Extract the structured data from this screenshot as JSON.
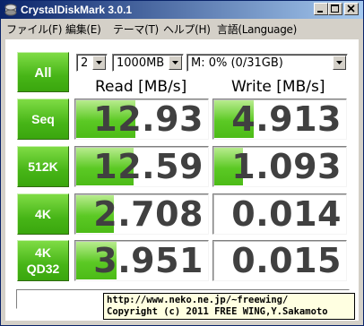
{
  "window": {
    "title": "CrystalDiskMark 3.0.1"
  },
  "menu": {
    "items": [
      "ファイル(F)",
      "編集(E)",
      "テーマ(T)",
      "ヘルプ(H)",
      "言語(Language)"
    ]
  },
  "controls": {
    "all_label": "All",
    "test_count": "2",
    "test_size": "1000MB",
    "drive": "M: 0% (0/31GB)"
  },
  "headers": {
    "read": "Read [MB/s]",
    "write": "Write [MB/s]"
  },
  "rows": [
    {
      "label": "Seq",
      "read": "12.93",
      "write": "4.913",
      "read_fill": 0.45,
      "write_fill": 0.3
    },
    {
      "label": "512K",
      "read": "12.59",
      "write": "1.093",
      "read_fill": 0.44,
      "write_fill": 0.22
    },
    {
      "label": "4K",
      "read": "2.708",
      "write": "0.014",
      "read_fill": 0.29,
      "write_fill": 0.0
    },
    {
      "label": "4K",
      "label2": "QD32",
      "read": "3.951",
      "write": "0.015",
      "read_fill": 0.31,
      "write_fill": 0.0
    }
  ],
  "footer": {
    "comment": "",
    "tooltip_line1": "http://www.neko.ne.jp/~freewing/",
    "tooltip_line2": "Copyright (c) 2011 FREE WING,Y.Sakamoto"
  },
  "colors": {
    "title_start": "#0a246a",
    "title_end": "#a6caf0",
    "button_green": "#47b517",
    "bar_green": "#5bc924",
    "tooltip_bg": "#ffffe1"
  }
}
